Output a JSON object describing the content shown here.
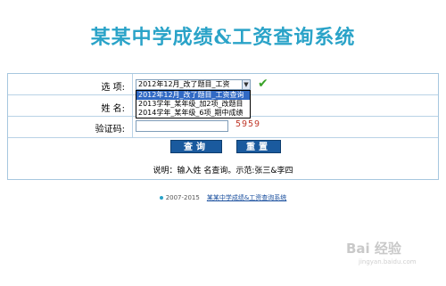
{
  "page_title": "某某中学成绩&工资查询系统",
  "form": {
    "option_label": "选  项:",
    "option_selected": "2012年12月_改了题目_工资",
    "option_list": [
      "2012年12月_改了题目_工资查询",
      "2013学年_某年级_加2项_改题目",
      "2014学年_某年级_6项_期中成绩"
    ],
    "name_label": "姓  名:",
    "name_value": "",
    "captcha_label": "验证码:",
    "captcha_value": "",
    "captcha_code": "5959",
    "query_button": "查询",
    "reset_button": "重置",
    "note": "说明：输入姓   名查询。示范:张三&李四"
  },
  "footer": {
    "copyright": "2007-2015",
    "link_text": "某某中学成绩&工资查询系统"
  },
  "watermark": {
    "brand": "Bai 经验",
    "url": "jingyan.baidu.com"
  },
  "colors": {
    "title": "#2aa3c8",
    "button": "#1a5a9e",
    "border": "#a7c7df",
    "selection": "#316ac5",
    "captcha": "#c0392b",
    "checkmark": "#3aa329"
  }
}
